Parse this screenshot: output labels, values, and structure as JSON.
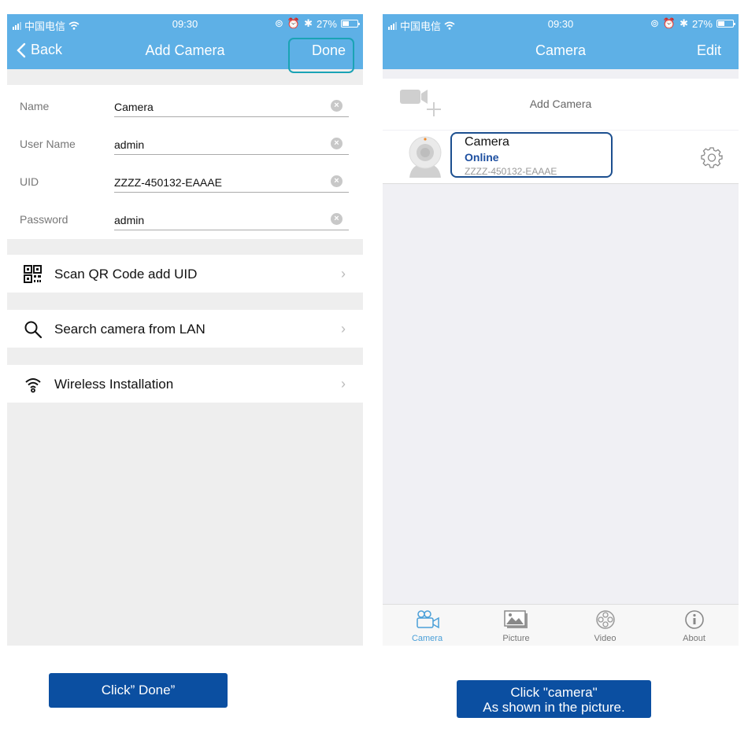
{
  "status_bar": {
    "carrier": "中国电信",
    "time": "09:30",
    "battery_text": "27%",
    "battery_level": 0.27
  },
  "left_screen": {
    "nav": {
      "back_label": "Back",
      "title": "Add Camera",
      "done_label": "Done"
    },
    "form": {
      "fields": [
        {
          "label": "Name",
          "value": "Camera"
        },
        {
          "label": "User Name",
          "value": "admin"
        },
        {
          "label": "UID",
          "value": "ZZZZ-450132-EAAAE"
        },
        {
          "label": "Password",
          "value": "admin"
        }
      ]
    },
    "menu": [
      {
        "label": "Scan QR Code add UID",
        "icon": "qr-code-icon"
      },
      {
        "label": "Search camera from LAN",
        "icon": "search-icon"
      },
      {
        "label": "Wireless Installation",
        "icon": "wifi-icon"
      }
    ]
  },
  "right_screen": {
    "nav": {
      "title": "Camera",
      "edit_label": "Edit"
    },
    "add_camera_label": "Add Camera",
    "cameras": [
      {
        "name": "Camera",
        "status": "Online",
        "uid": "ZZZZ-450132-EAAAE"
      }
    ],
    "tabs": [
      {
        "label": "Camera",
        "icon": "video-camera-icon",
        "active": true
      },
      {
        "label": "Picture",
        "icon": "picture-icon",
        "active": false
      },
      {
        "label": "Video",
        "icon": "film-reel-icon",
        "active": false
      },
      {
        "label": "About",
        "icon": "info-icon",
        "active": false
      }
    ]
  },
  "captions": {
    "left": "Click” Done”",
    "right_line1": "Click \"camera\"",
    "right_line2": "As shown in the picture."
  },
  "colors": {
    "nav_blue": "#5eb0e6",
    "done_highlight": "#1aa3b5",
    "camera_highlight": "#1c4f8f",
    "online_text": "#1d4fa0",
    "caption_bg": "#0b4fa1"
  }
}
